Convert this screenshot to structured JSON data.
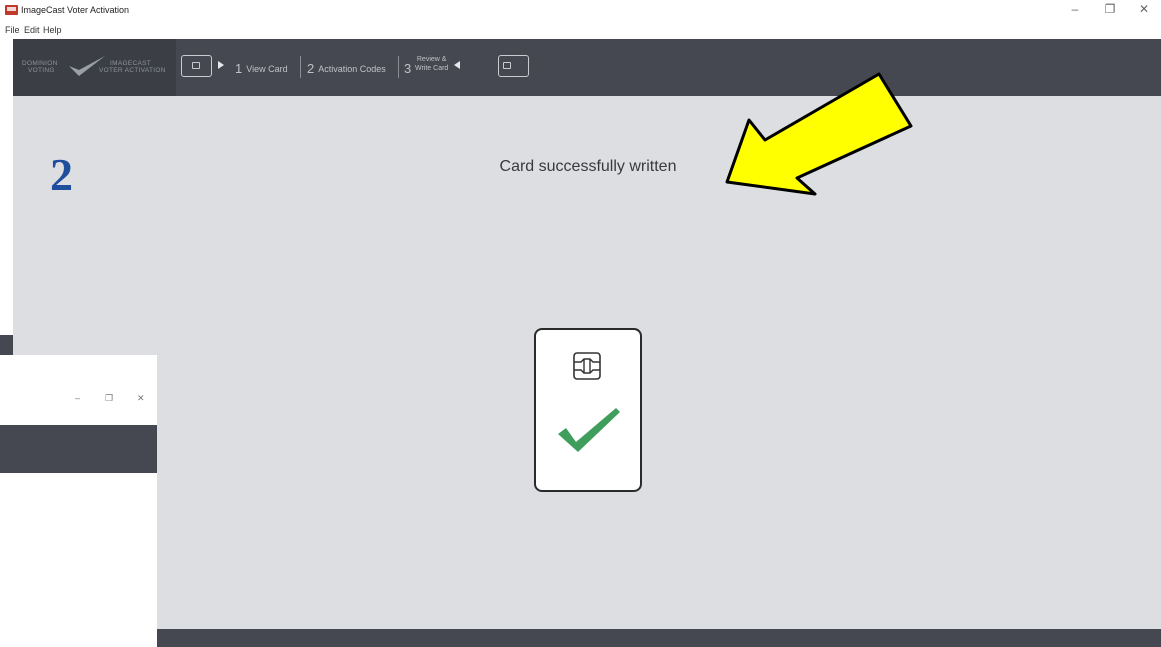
{
  "window": {
    "title": "ImageCast Voter Activation",
    "minimize": "–",
    "maximize": "❐",
    "close": "✕"
  },
  "menu": {
    "file": "File",
    "edit": "Edit",
    "help": "Help"
  },
  "logo": {
    "left_line1": "DOMINION",
    "left_line2": "VOTING",
    "right_line1": "IMAGECAST",
    "right_line2": "VOTER ACTIVATION"
  },
  "steps": [
    {
      "num": "1",
      "label": "View Card"
    },
    {
      "num": "2",
      "label": "Activation Codes"
    },
    {
      "num": "3",
      "label_line1": "Review &",
      "label_line2": "Write Card"
    }
  ],
  "annotation": {
    "number": "2"
  },
  "main": {
    "status_message": "Card successfully written"
  },
  "background_window": {
    "minimize": "–",
    "maximize": "❐",
    "close": "✕"
  },
  "colors": {
    "nav_bg": "#454850",
    "content_bg": "#dcdee2",
    "annotation_blue": "#1f4e9c",
    "check_green": "#3f9e5c",
    "arrow_yellow": "#ffff00"
  }
}
